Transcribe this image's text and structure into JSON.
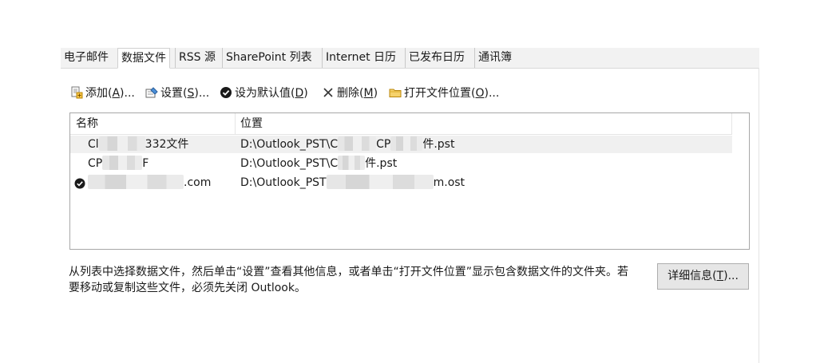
{
  "tabs": [
    {
      "label": "电子邮件",
      "active": false
    },
    {
      "label": "数据文件",
      "active": true
    },
    {
      "label": "RSS 源",
      "active": false
    },
    {
      "label": "SharePoint 列表",
      "active": false
    },
    {
      "label": "Internet 日历",
      "active": false
    },
    {
      "label": "已发布日历",
      "active": false
    },
    {
      "label": "通讯簿",
      "active": false
    }
  ],
  "toolbar": {
    "add": {
      "text": "添加(",
      "key": "A",
      "tail": ")..."
    },
    "settings": {
      "text": "设置(",
      "key": "S",
      "tail": ")..."
    },
    "set_default": {
      "text": "设为默认值(",
      "key": "D",
      "tail": ")"
    },
    "remove": {
      "text": "删除(",
      "key": "M",
      "tail": ")"
    },
    "open_location": {
      "text": "打开文件位置(",
      "key": "O",
      "tail": ")..."
    }
  },
  "list": {
    "headers": {
      "name": "名称",
      "location": "位置"
    },
    "rows": [
      {
        "name_pre": "Cl",
        "name_post": "332文件",
        "loc_pre": "D:\\Outlook_PST\\C",
        "loc_mid": "CP",
        "loc_post": "件.pst",
        "default": false,
        "selected": true
      },
      {
        "name_pre": "CP",
        "name_post": "F",
        "loc_pre": "D:\\Outlook_PST\\C",
        "loc_mid": "",
        "loc_post": "件.pst",
        "default": false,
        "selected": false
      },
      {
        "name_pre": "",
        "name_post": ".com",
        "loc_pre": "D:\\Outlook_PST",
        "loc_mid": "",
        "loc_post": "m.ost",
        "default": true,
        "selected": false
      }
    ]
  },
  "help_text": "从列表中选择数据文件，然后单击“设置”查看其他信息，或者单击“打开文件位置”显示包含数据文件的文件夹。若要移动或复制这些文件，必须先关闭 Outlook。",
  "details_button": {
    "text": "详细信息(",
    "key": "T",
    "tail": ")..."
  }
}
